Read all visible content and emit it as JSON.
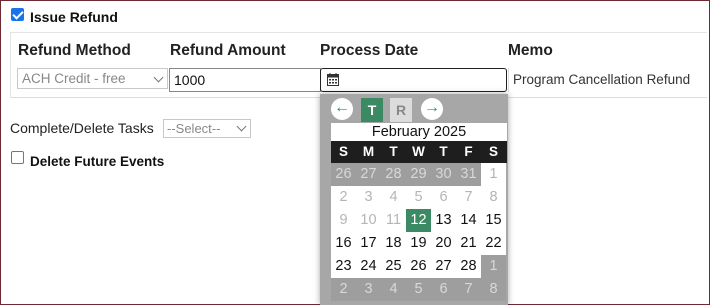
{
  "issue_refund": {
    "label": "Issue Refund",
    "checked": true
  },
  "columns": {
    "refund_method": "Refund Method",
    "refund_amount": "Refund Amount",
    "process_date": "Process Date",
    "memo": "Memo"
  },
  "fields": {
    "refund_method_value": "ACH Credit - free",
    "refund_amount_value": "1000",
    "process_date_value": "",
    "memo_value": "Program Cancellation Refund"
  },
  "tasks": {
    "label": "Complete/Delete Tasks",
    "select_value": "--Select--"
  },
  "delete_future": {
    "label": "Delete Future Events",
    "checked": false
  },
  "datepicker": {
    "prev": "←",
    "next": "→",
    "tab_t": "T",
    "tab_r": "R",
    "month_label": "February 2025",
    "weekdays": [
      "S",
      "M",
      "T",
      "W",
      "T",
      "F",
      "S"
    ],
    "selected_day": "12",
    "weeks": [
      [
        {
          "d": "26",
          "k": "other"
        },
        {
          "d": "27",
          "k": "other"
        },
        {
          "d": "28",
          "k": "other"
        },
        {
          "d": "29",
          "k": "other"
        },
        {
          "d": "30",
          "k": "other"
        },
        {
          "d": "31",
          "k": "other"
        },
        {
          "d": "1",
          "k": "disabled"
        }
      ],
      [
        {
          "d": "2",
          "k": "disabled"
        },
        {
          "d": "3",
          "k": "disabled"
        },
        {
          "d": "4",
          "k": "disabled"
        },
        {
          "d": "5",
          "k": "disabled"
        },
        {
          "d": "6",
          "k": "disabled"
        },
        {
          "d": "7",
          "k": "disabled"
        },
        {
          "d": "8",
          "k": "disabled"
        }
      ],
      [
        {
          "d": "9",
          "k": "disabled"
        },
        {
          "d": "10",
          "k": "disabled"
        },
        {
          "d": "11",
          "k": "disabled"
        },
        {
          "d": "12",
          "k": "sel"
        },
        {
          "d": "13",
          "k": "cur"
        },
        {
          "d": "14",
          "k": "cur"
        },
        {
          "d": "15",
          "k": "cur"
        }
      ],
      [
        {
          "d": "16",
          "k": "cur"
        },
        {
          "d": "17",
          "k": "cur"
        },
        {
          "d": "18",
          "k": "cur"
        },
        {
          "d": "19",
          "k": "cur"
        },
        {
          "d": "20",
          "k": "cur"
        },
        {
          "d": "21",
          "k": "cur"
        },
        {
          "d": "22",
          "k": "cur"
        }
      ],
      [
        {
          "d": "23",
          "k": "cur"
        },
        {
          "d": "24",
          "k": "cur"
        },
        {
          "d": "25",
          "k": "cur"
        },
        {
          "d": "26",
          "k": "cur"
        },
        {
          "d": "27",
          "k": "cur"
        },
        {
          "d": "28",
          "k": "cur"
        },
        {
          "d": "1",
          "k": "other"
        }
      ],
      [
        {
          "d": "2",
          "k": "other"
        },
        {
          "d": "3",
          "k": "other"
        },
        {
          "d": "4",
          "k": "other"
        },
        {
          "d": "5",
          "k": "other"
        },
        {
          "d": "6",
          "k": "other"
        },
        {
          "d": "7",
          "k": "other"
        },
        {
          "d": "8",
          "k": "other"
        }
      ]
    ]
  }
}
